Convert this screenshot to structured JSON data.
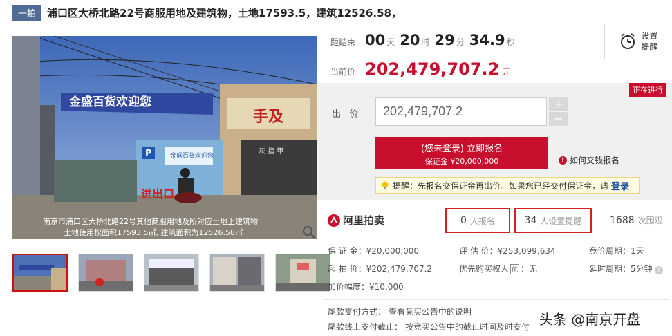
{
  "title": {
    "badge": "一拍",
    "text": "浦口区大桥北路22号商服用地及建筑物，土地17593.5，建筑12526.58，"
  },
  "photo": {
    "sign_text": "金盛百货欢迎您",
    "store_sign": "金盛百货欢迎您",
    "shop_sign_right": "手及",
    "shop_sub": "灰 指 甲",
    "entrance_text": "进出口",
    "parking": "P",
    "caption_line1": "南京市浦口区大桥北路22号其他商服用地及所对应土地上建筑物",
    "caption_line2": "土地使用权面积17593.5㎡, 建筑面积为12526.58㎡"
  },
  "countdown": {
    "label": "距结束",
    "days": "00",
    "days_unit": "天",
    "hours": "20",
    "hours_unit": "时",
    "minutes": "29",
    "minutes_unit": "分",
    "seconds": "34.9",
    "seconds_unit": "秒"
  },
  "current_price": {
    "label": "当前价",
    "value": "202,479,707.2",
    "unit": "元"
  },
  "reminder": {
    "line1": "设置",
    "line2": "提醒",
    "icon": "alarm-clock-icon"
  },
  "bid": {
    "status": "正在进行",
    "label": "出 价",
    "input_value": "202,479,707.2",
    "plus": "+",
    "minus": "−",
    "signup_main": "(您未登录) 立即报名",
    "signup_sub": "保证金 ¥20,000,000",
    "howto": "如何交钱报名",
    "tip_text": "提醒：先报名交保证金再出价。如果您已经交付保证金，请",
    "tip_link": "登录"
  },
  "brand": {
    "name": "阿里拍卖"
  },
  "stats": {
    "signups": "0",
    "signups_unit": "人报名",
    "reminders": "34",
    "reminders_unit": "人设置提醒",
    "views": "1688",
    "views_unit": "次围观"
  },
  "details": {
    "deposit": "保 证 金：¥20,000,000",
    "appraisal": "评 估 价：¥253,099,634",
    "bid_cycle": "竞价周期：1天",
    "start_price": "起 拍 价：¥202,479,707.2",
    "priority_label": "优先购买权人",
    "priority_mark": "优",
    "priority_value": "：无",
    "delay_cycle": "延时周期：5分钟",
    "increment": "加价幅度：¥10,000",
    "payment_method": "尾款支付方式：  查看竞买公告中的说明",
    "payment_deadline": "尾款线上支付截止：  按竞买公告中的截止时间及时支付"
  },
  "watermark": "头条 @南京开盘",
  "colors": {
    "accent": "#c8102e",
    "badge": "#4f6b96",
    "stat_border": "#d42020"
  }
}
